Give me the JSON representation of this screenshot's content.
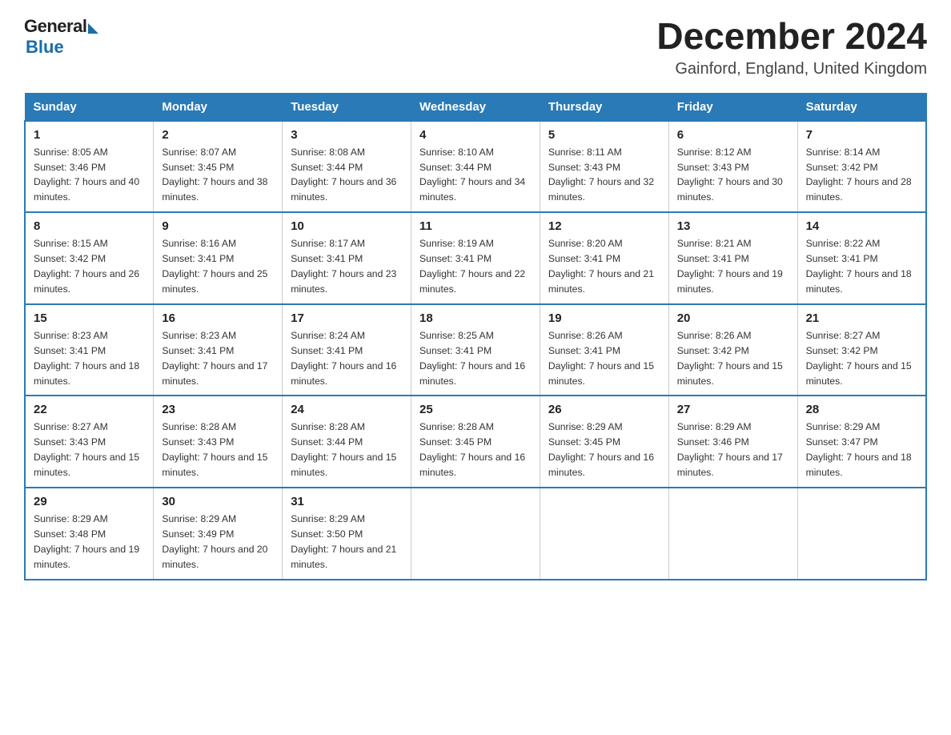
{
  "header": {
    "logo_general": "General",
    "logo_blue": "Blue",
    "month_title": "December 2024",
    "location": "Gainford, England, United Kingdom"
  },
  "days_of_week": [
    "Sunday",
    "Monday",
    "Tuesday",
    "Wednesday",
    "Thursday",
    "Friday",
    "Saturday"
  ],
  "weeks": [
    [
      {
        "day": "1",
        "sunrise": "8:05 AM",
        "sunset": "3:46 PM",
        "daylight": "7 hours and 40 minutes."
      },
      {
        "day": "2",
        "sunrise": "8:07 AM",
        "sunset": "3:45 PM",
        "daylight": "7 hours and 38 minutes."
      },
      {
        "day": "3",
        "sunrise": "8:08 AM",
        "sunset": "3:44 PM",
        "daylight": "7 hours and 36 minutes."
      },
      {
        "day": "4",
        "sunrise": "8:10 AM",
        "sunset": "3:44 PM",
        "daylight": "7 hours and 34 minutes."
      },
      {
        "day": "5",
        "sunrise": "8:11 AM",
        "sunset": "3:43 PM",
        "daylight": "7 hours and 32 minutes."
      },
      {
        "day": "6",
        "sunrise": "8:12 AM",
        "sunset": "3:43 PM",
        "daylight": "7 hours and 30 minutes."
      },
      {
        "day": "7",
        "sunrise": "8:14 AM",
        "sunset": "3:42 PM",
        "daylight": "7 hours and 28 minutes."
      }
    ],
    [
      {
        "day": "8",
        "sunrise": "8:15 AM",
        "sunset": "3:42 PM",
        "daylight": "7 hours and 26 minutes."
      },
      {
        "day": "9",
        "sunrise": "8:16 AM",
        "sunset": "3:41 PM",
        "daylight": "7 hours and 25 minutes."
      },
      {
        "day": "10",
        "sunrise": "8:17 AM",
        "sunset": "3:41 PM",
        "daylight": "7 hours and 23 minutes."
      },
      {
        "day": "11",
        "sunrise": "8:19 AM",
        "sunset": "3:41 PM",
        "daylight": "7 hours and 22 minutes."
      },
      {
        "day": "12",
        "sunrise": "8:20 AM",
        "sunset": "3:41 PM",
        "daylight": "7 hours and 21 minutes."
      },
      {
        "day": "13",
        "sunrise": "8:21 AM",
        "sunset": "3:41 PM",
        "daylight": "7 hours and 19 minutes."
      },
      {
        "day": "14",
        "sunrise": "8:22 AM",
        "sunset": "3:41 PM",
        "daylight": "7 hours and 18 minutes."
      }
    ],
    [
      {
        "day": "15",
        "sunrise": "8:23 AM",
        "sunset": "3:41 PM",
        "daylight": "7 hours and 18 minutes."
      },
      {
        "day": "16",
        "sunrise": "8:23 AM",
        "sunset": "3:41 PM",
        "daylight": "7 hours and 17 minutes."
      },
      {
        "day": "17",
        "sunrise": "8:24 AM",
        "sunset": "3:41 PM",
        "daylight": "7 hours and 16 minutes."
      },
      {
        "day": "18",
        "sunrise": "8:25 AM",
        "sunset": "3:41 PM",
        "daylight": "7 hours and 16 minutes."
      },
      {
        "day": "19",
        "sunrise": "8:26 AM",
        "sunset": "3:41 PM",
        "daylight": "7 hours and 15 minutes."
      },
      {
        "day": "20",
        "sunrise": "8:26 AM",
        "sunset": "3:42 PM",
        "daylight": "7 hours and 15 minutes."
      },
      {
        "day": "21",
        "sunrise": "8:27 AM",
        "sunset": "3:42 PM",
        "daylight": "7 hours and 15 minutes."
      }
    ],
    [
      {
        "day": "22",
        "sunrise": "8:27 AM",
        "sunset": "3:43 PM",
        "daylight": "7 hours and 15 minutes."
      },
      {
        "day": "23",
        "sunrise": "8:28 AM",
        "sunset": "3:43 PM",
        "daylight": "7 hours and 15 minutes."
      },
      {
        "day": "24",
        "sunrise": "8:28 AM",
        "sunset": "3:44 PM",
        "daylight": "7 hours and 15 minutes."
      },
      {
        "day": "25",
        "sunrise": "8:28 AM",
        "sunset": "3:45 PM",
        "daylight": "7 hours and 16 minutes."
      },
      {
        "day": "26",
        "sunrise": "8:29 AM",
        "sunset": "3:45 PM",
        "daylight": "7 hours and 16 minutes."
      },
      {
        "day": "27",
        "sunrise": "8:29 AM",
        "sunset": "3:46 PM",
        "daylight": "7 hours and 17 minutes."
      },
      {
        "day": "28",
        "sunrise": "8:29 AM",
        "sunset": "3:47 PM",
        "daylight": "7 hours and 18 minutes."
      }
    ],
    [
      {
        "day": "29",
        "sunrise": "8:29 AM",
        "sunset": "3:48 PM",
        "daylight": "7 hours and 19 minutes."
      },
      {
        "day": "30",
        "sunrise": "8:29 AM",
        "sunset": "3:49 PM",
        "daylight": "7 hours and 20 minutes."
      },
      {
        "day": "31",
        "sunrise": "8:29 AM",
        "sunset": "3:50 PM",
        "daylight": "7 hours and 21 minutes."
      },
      null,
      null,
      null,
      null
    ]
  ]
}
